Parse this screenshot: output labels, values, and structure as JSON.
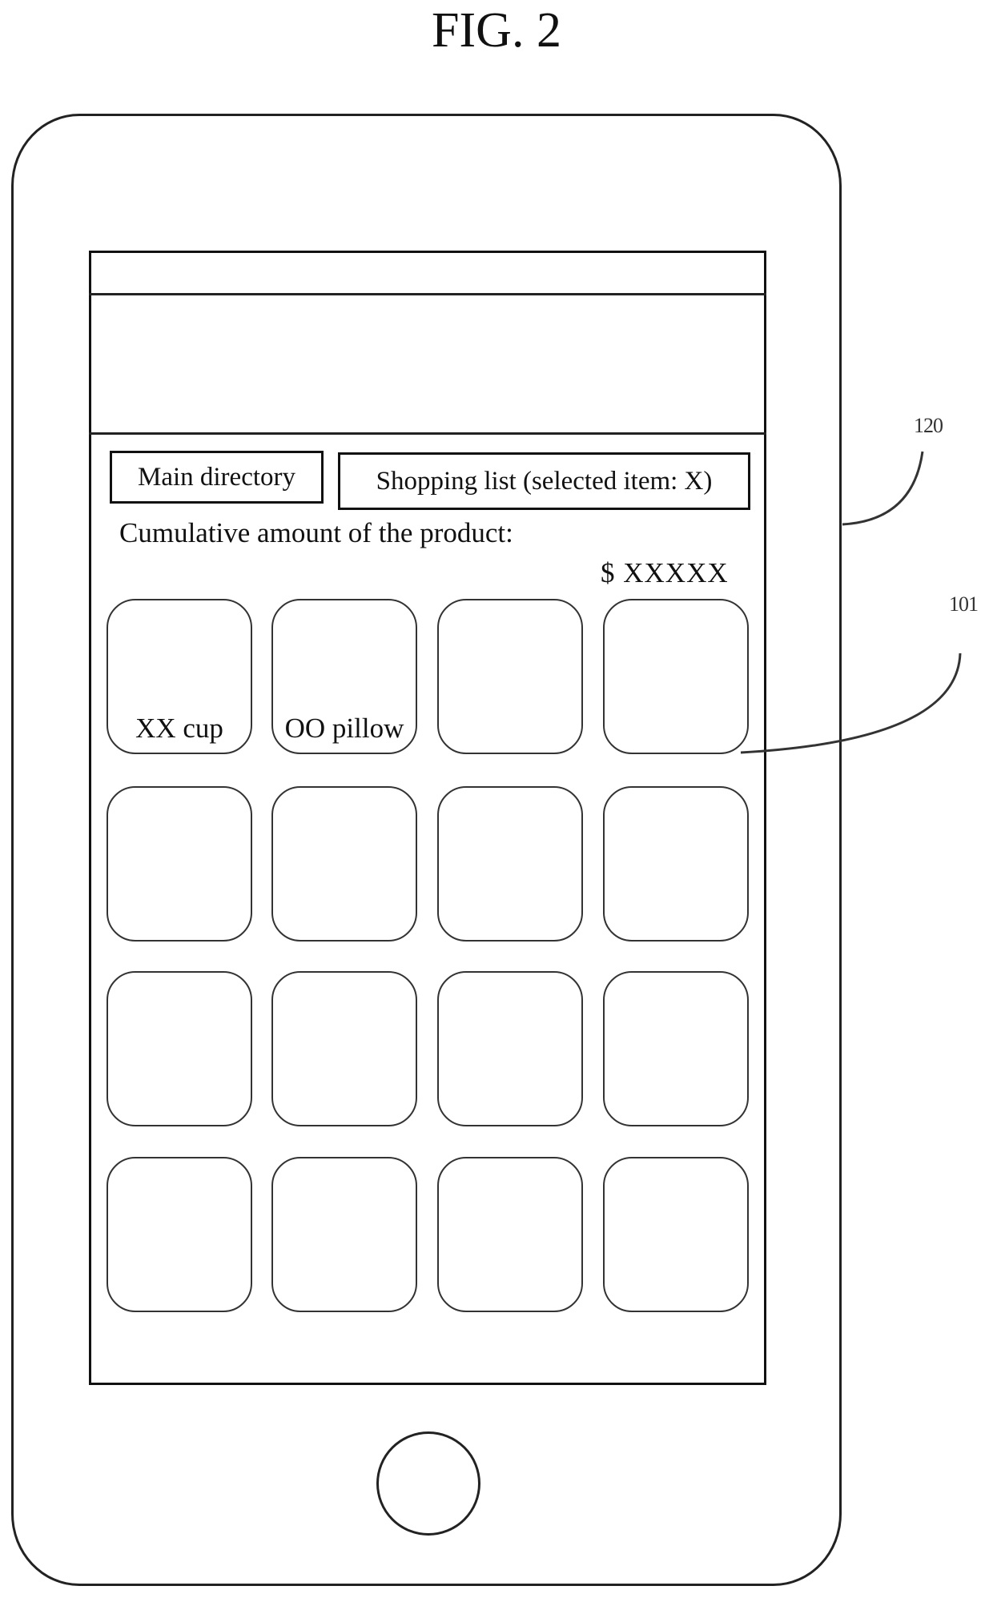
{
  "figure": {
    "title": "FIG. 2",
    "reference_labels": {
      "device": "120",
      "item_tile": "101"
    }
  },
  "screen": {
    "status_bar": {},
    "header": {},
    "nav": {
      "main_directory_label": "Main directory",
      "shopping_list_label": "Shopping list (selected item: X)"
    },
    "summary": {
      "cumulative_label": "Cumulative amount of the product:",
      "amount_value": "$ XXXXX"
    },
    "grid": {
      "columns": 4,
      "rows": 4,
      "tiles": [
        {
          "label": "XX cup"
        },
        {
          "label": "OO pillow"
        },
        {
          "label": ""
        },
        {
          "label": ""
        },
        {
          "label": ""
        },
        {
          "label": ""
        },
        {
          "label": ""
        },
        {
          "label": ""
        },
        {
          "label": ""
        },
        {
          "label": ""
        },
        {
          "label": ""
        },
        {
          "label": ""
        },
        {
          "label": ""
        },
        {
          "label": ""
        },
        {
          "label": ""
        },
        {
          "label": ""
        }
      ]
    }
  },
  "device": {
    "home_button_icon": "home-button-circle"
  }
}
